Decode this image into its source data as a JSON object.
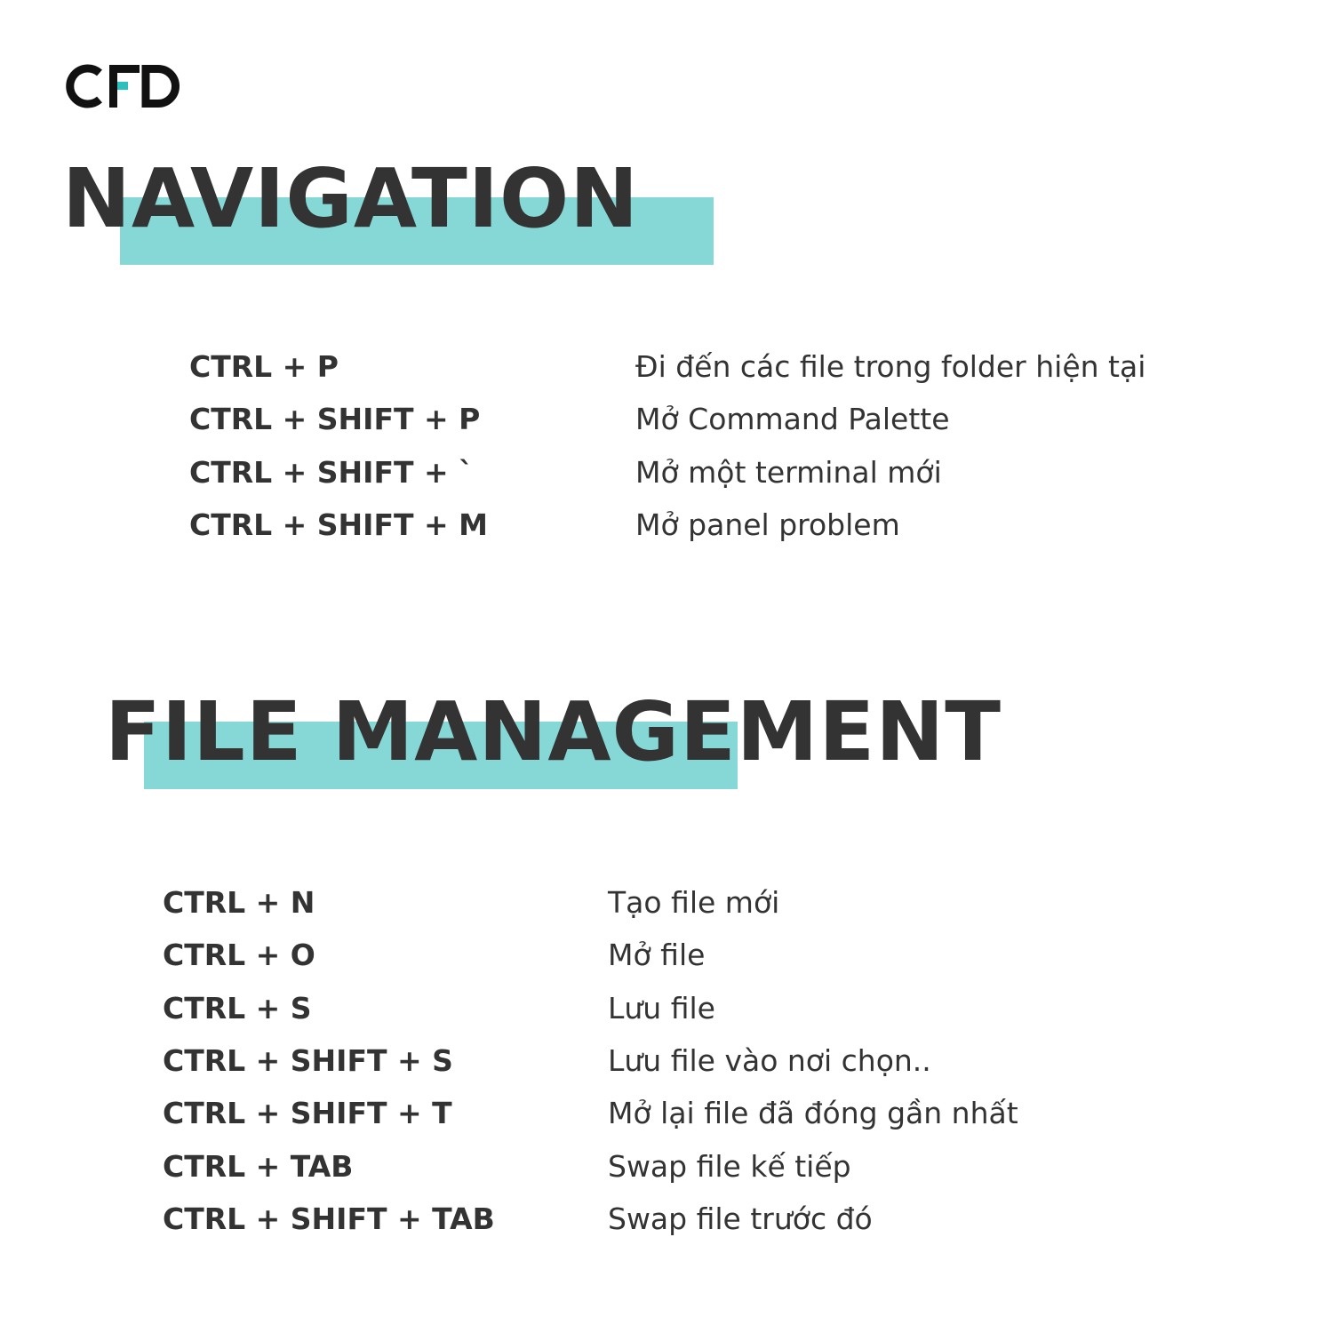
{
  "brand": {
    "logo_text": "CFD",
    "accent_color": "#2bbfbd",
    "highlight_color": "#85d8d6",
    "text_color": "#333333"
  },
  "navigation": {
    "title": "NAVIGATION",
    "shortcuts": [
      {
        "keys": "CTRL + P",
        "description": "Đi đến các file trong folder hiện tại"
      },
      {
        "keys": "CTRL + SHIFT + P",
        "description": "Mở Command Palette"
      },
      {
        "keys": "CTRL + SHIFT + `",
        "description": "Mở một terminal mới"
      },
      {
        "keys": "CTRL + SHIFT + M",
        "description": "Mở panel problem"
      }
    ]
  },
  "file_management": {
    "title": "FILE MANAGEMENT",
    "shortcuts": [
      {
        "keys": "CTRL + N",
        "description": "Tạo file mới"
      },
      {
        "keys": "CTRL + O",
        "description": "Mở file"
      },
      {
        "keys": "CTRL + S",
        "description": "Lưu file"
      },
      {
        "keys": "CTRL + SHIFT + S",
        "description": "Lưu file vào nơi chọn.."
      },
      {
        "keys": "CTRL + SHIFT + T",
        "description": "Mở lại file đã đóng gần nhất"
      },
      {
        "keys": "CTRL + TAB",
        "description": "Swap file kế tiếp"
      },
      {
        "keys": "CTRL + SHIFT + TAB",
        "description": "Swap file trước đó"
      }
    ]
  }
}
